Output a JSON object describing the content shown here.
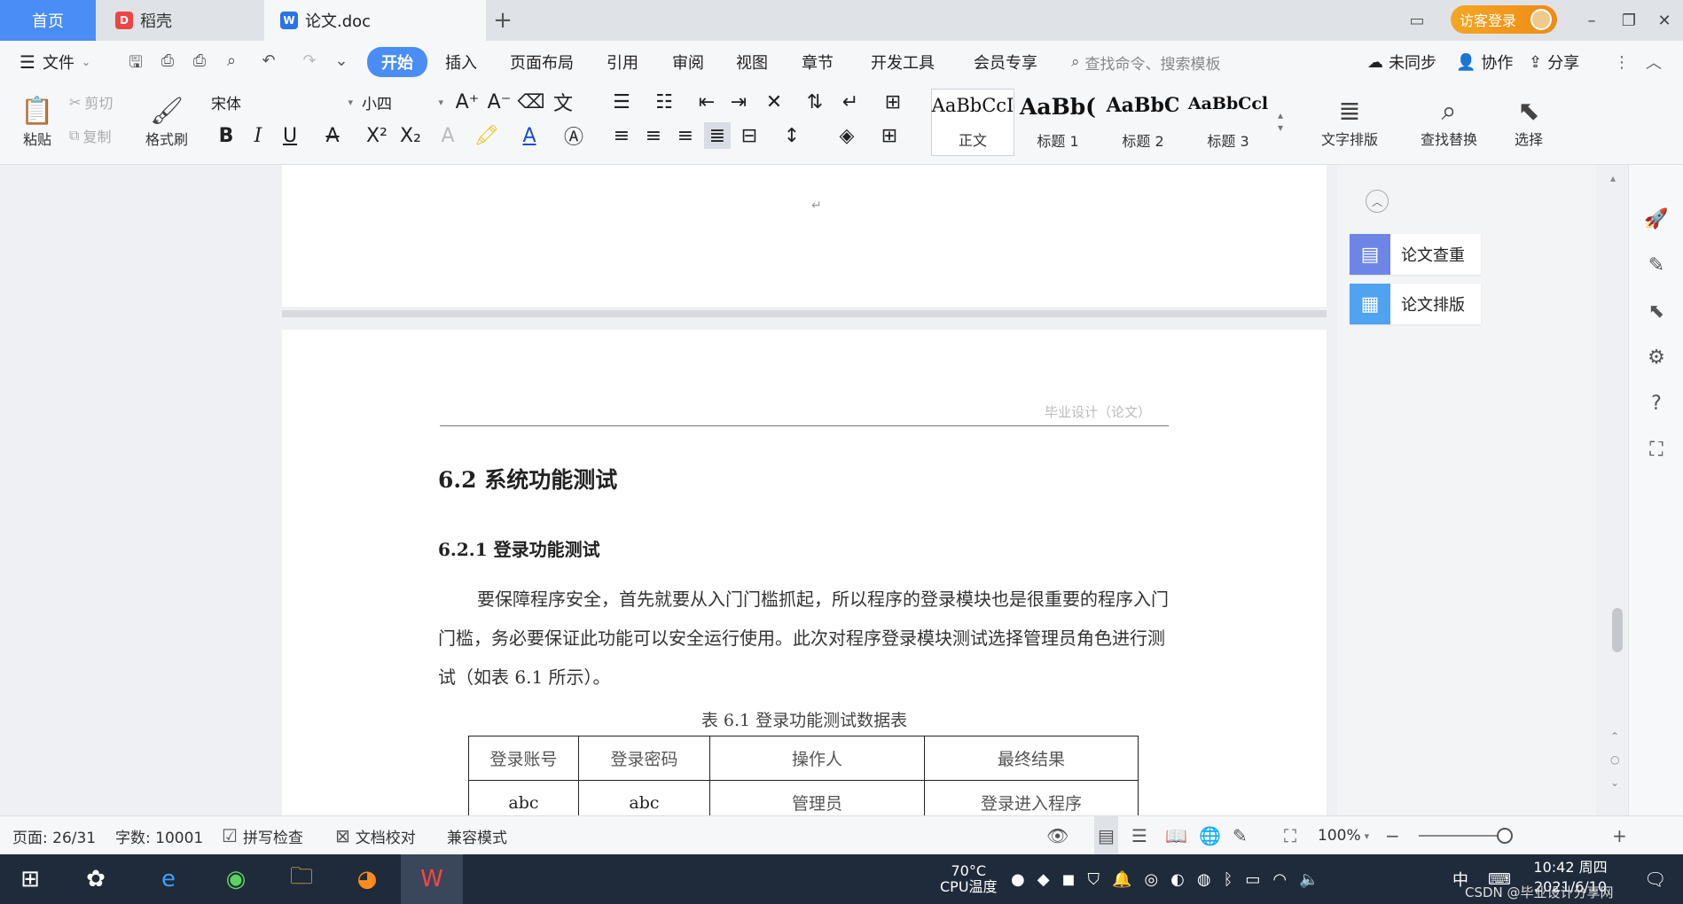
{
  "tabs": {
    "home": "首页",
    "daoke": "稻壳",
    "doc": "论文.doc",
    "add": "+"
  },
  "titlebar": {
    "login": "访客登录",
    "min": "–",
    "restore": "❐",
    "close": "✕"
  },
  "menu": {
    "file": "文件",
    "items": [
      "开始",
      "插入",
      "页面布局",
      "引用",
      "审阅",
      "视图",
      "章节",
      "开发工具",
      "会员专享"
    ],
    "search": "查找命令、搜索模板",
    "sync": "未同步",
    "collab": "协作",
    "share": "分享"
  },
  "ribbon": {
    "paste": "粘贴",
    "cut": "剪切",
    "copy": "复制",
    "format_painter": "格式刷",
    "font_name": "宋体",
    "font_size": "小四",
    "styles": [
      {
        "preview": "AaBbCcI",
        "label": "正文"
      },
      {
        "preview": "AaBb(",
        "label": "标题 1"
      },
      {
        "preview": "AaBbC",
        "label": "标题 2"
      },
      {
        "preview": "AaBbCcl",
        "label": "标题 3"
      }
    ],
    "text_layout": "文字排版",
    "find_replace": "查找替换",
    "select": "选择"
  },
  "document": {
    "para_mark": "↵",
    "header_text": "毕业设计（论文）",
    "section_title": "6.2  系统功能测试",
    "subsection_title": "6.2.1  登录功能测试",
    "body": "要保障程序安全，首先就要从入门门槛抓起，所以程序的登录模块也是很重要的程序入门门槛，务必要保证此功能可以安全运行使用。此次对程序登录模块测试选择管理员角色进行测试（如表 6.1 所示）。",
    "table_caption": "表 6.1  登录功能测试数据表",
    "table": {
      "headers": [
        "登录账号",
        "登录密码",
        "操作人",
        "最终结果"
      ],
      "rows": [
        [
          "abc",
          "abc",
          "管理员",
          "登录进入程序"
        ]
      ]
    }
  },
  "side_panel": {
    "check": "论文查重",
    "layout": "论文排版"
  },
  "status": {
    "page": "页面: 26/31",
    "words": "字数: 10001",
    "spell": "拼写检查",
    "proof": "文档校对",
    "compat": "兼容模式",
    "zoom": "100%",
    "zoom_value": 100
  },
  "taskbar": {
    "cpu_temp": "70°C",
    "cpu_label": "CPU温度",
    "ime": "中",
    "time": "10:42 周四",
    "date": "2021/6/10",
    "watermark": "CSDN @毕业设计分享网"
  },
  "colors": {
    "accent": "#4a8df7",
    "login": "#f08a16"
  }
}
